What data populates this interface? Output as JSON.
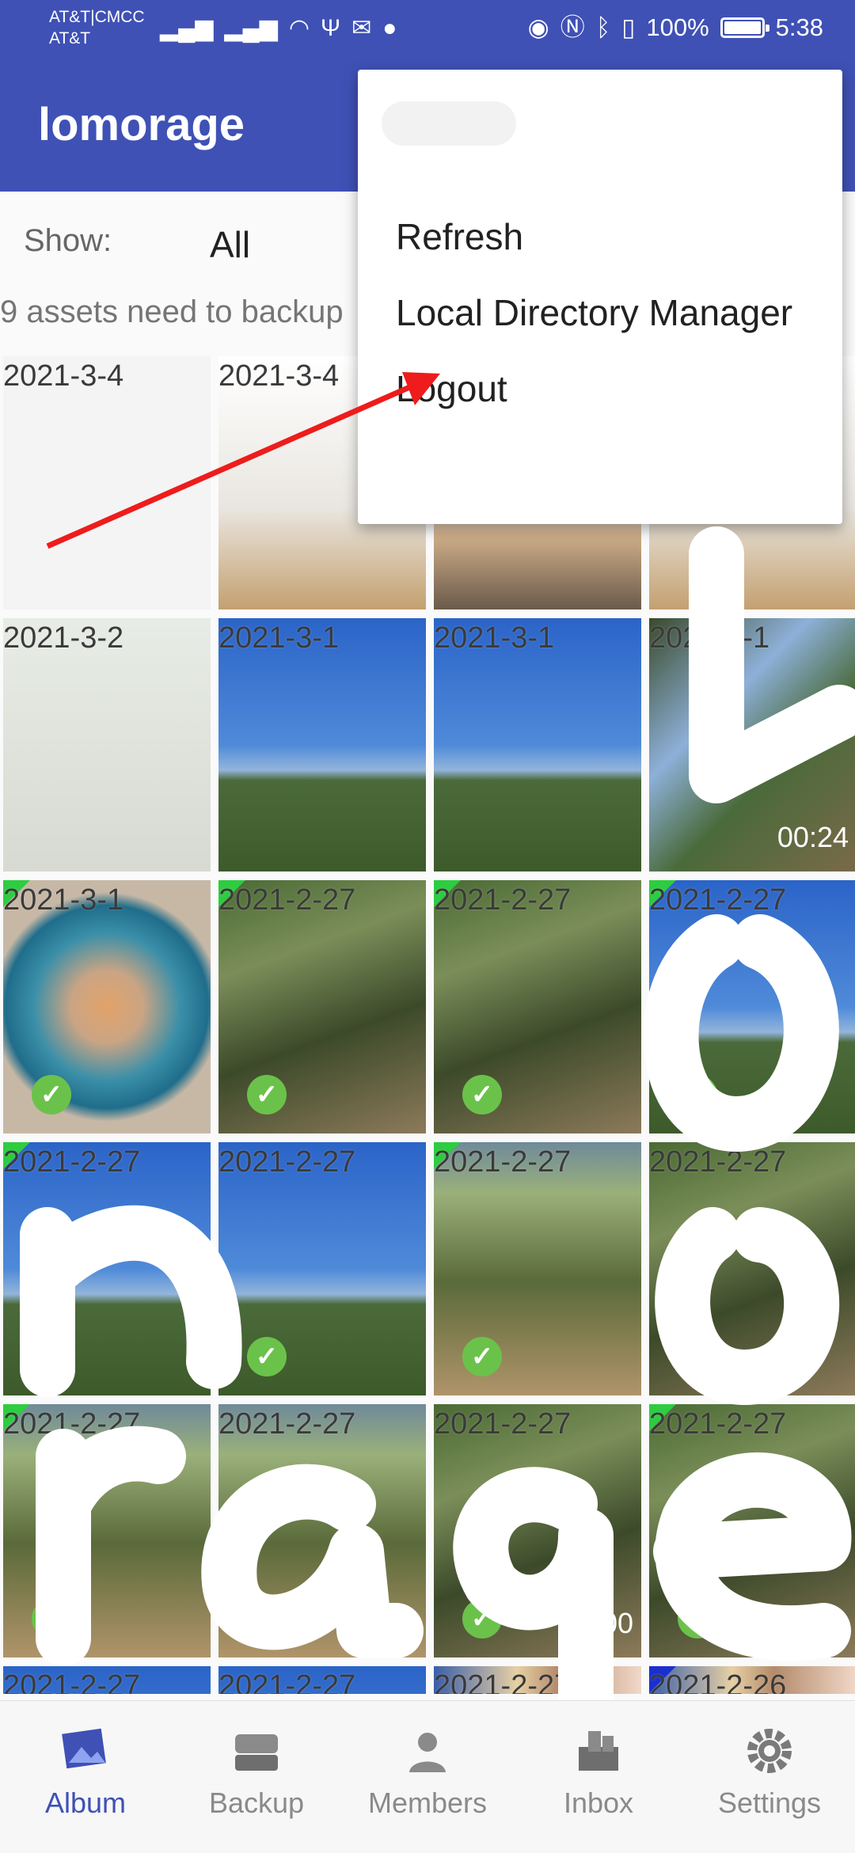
{
  "status": {
    "carrier_line1": "AT&T|CMCC",
    "carrier_line2": "AT&T",
    "battery": "100%",
    "battery_level": 1.0,
    "time": "5:38"
  },
  "appbar": {
    "title": "lomorage"
  },
  "filter": {
    "label": "Show:",
    "value": "All"
  },
  "assets_message": "9 assets need to backup",
  "menu": {
    "items": [
      "Refresh",
      "Local Directory Manager",
      "Logout"
    ]
  },
  "tiles": [
    {
      "date": "2021-3-4"
    },
    {
      "date": "2021-3-4"
    },
    {
      "date": ""
    },
    {
      "date": ""
    },
    {
      "date": "2021-3-2"
    },
    {
      "date": "2021-3-1"
    },
    {
      "date": "2021-3-1"
    },
    {
      "date": "2021-3-1",
      "duration": "00:24"
    },
    {
      "date": "2021-3-1"
    },
    {
      "date": "2021-2-27"
    },
    {
      "date": "2021-2-27"
    },
    {
      "date": "2021-2-27"
    },
    {
      "date": "2021-2-27"
    },
    {
      "date": "2021-2-27"
    },
    {
      "date": "2021-2-27"
    },
    {
      "date": "2021-2-27"
    },
    {
      "date": "2021-2-27"
    },
    {
      "date": "2021-2-27"
    },
    {
      "date": "2021-2-27",
      "duration": "00"
    },
    {
      "date": "2021-2-27"
    },
    {
      "date": "2021-2-27"
    },
    {
      "date": "2021-2-27"
    },
    {
      "date": "2021-2-27"
    },
    {
      "date": "2021-2-26"
    }
  ],
  "nav": {
    "items": [
      {
        "label": "Album",
        "icon": "album-icon"
      },
      {
        "label": "Backup",
        "icon": "backup-icon"
      },
      {
        "label": "Members",
        "icon": "members-icon"
      },
      {
        "label": "Inbox",
        "icon": "inbox-icon"
      },
      {
        "label": "Settings",
        "icon": "settings-icon"
      }
    ]
  },
  "colors": {
    "primary": "#3f51b5",
    "check": "#6bc24a",
    "arrow": "#ee1c1c"
  }
}
